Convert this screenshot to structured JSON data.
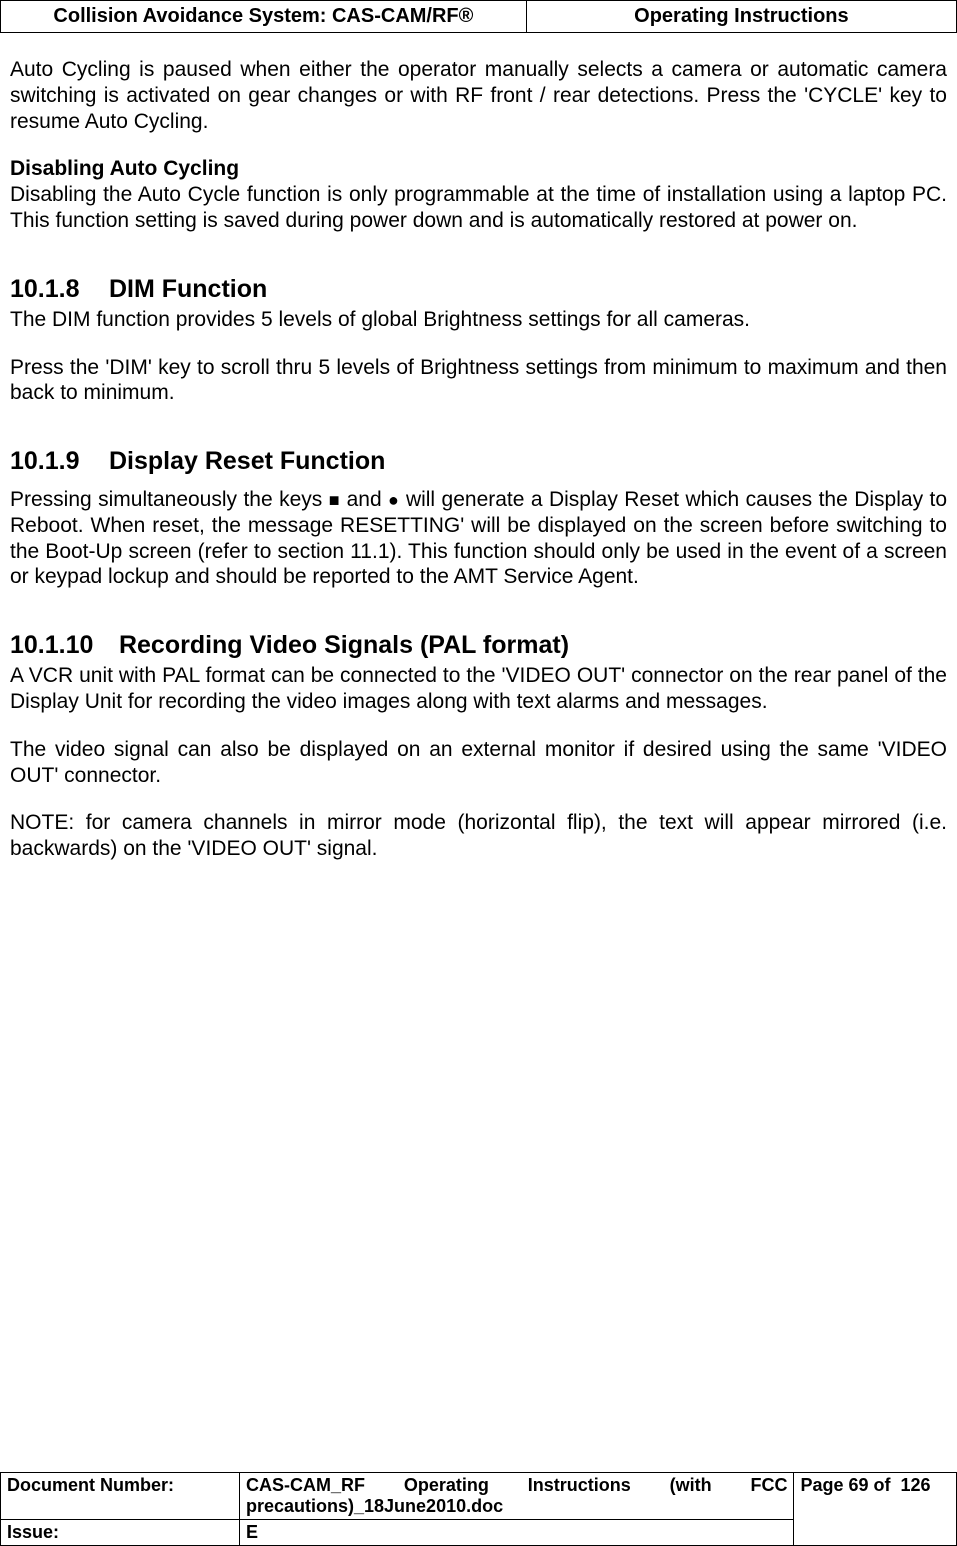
{
  "header": {
    "left": "Collision Avoidance System: CAS-CAM/RF®",
    "right": "Operating Instructions"
  },
  "body": {
    "intro_para": "Auto Cycling is paused when either the operator manually selects a camera or automatic camera switching is activated on gear changes or with RF front / rear detections. Press the 'CYCLE' key to resume Auto Cycling.",
    "disable_heading": "Disabling Auto Cycling",
    "disable_para": "Disabling the Auto Cycle function is only programmable at the time of installation using a laptop PC. This function setting is saved during power down and is automatically restored at power on.",
    "s1018_num": "10.1.8",
    "s1018_title": "DIM Function",
    "s1018_p1": "The DIM function provides 5 levels of global Brightness settings for all cameras.",
    "s1018_p2": "Press the 'DIM' key to scroll thru 5 levels of Brightness settings from minimum to maximum and then back to minimum.",
    "s1019_num": "10.1.9",
    "s1019_title": "Display Reset Function",
    "s1019_p1_a": "Pressing simultaneously the keys ",
    "s1019_p1_b": " and ",
    "s1019_p1_c": " will generate a Display Reset which causes the Display to Reboot. When reset, the message RESETTING' will be displayed on the screen before switching to the Boot-Up screen (refer to section 11.1). This function should only be used in the event of a screen or keypad lockup and should be reported to the AMT Service Agent.",
    "sym_square": "■",
    "sym_circle": "●",
    "s10110_num": "10.1.10",
    "s10110_title": "Recording Video Signals (PAL format)",
    "s10110_p1": "A VCR unit with PAL format can be connected to the 'VIDEO OUT' connector on the rear panel of the Display Unit for recording the video images along with text alarms and messages.",
    "s10110_p2": "The video signal can also be displayed on an external monitor if desired using the same 'VIDEO OUT' connector.",
    "s10110_p3": "NOTE: for camera channels in mirror mode (horizontal flip), the text will appear mirrored (i.e. backwards) on the 'VIDEO OUT' signal."
  },
  "footer": {
    "doc_num_label": "Document Number:",
    "doc_num_value": "CAS-CAM_RF Operating Instructions (with FCC precautions)_18June2010.doc",
    "page_label_a": "Page 69 of",
    "page_label_b": "126",
    "issue_label": "Issue:",
    "issue_value": "E"
  }
}
